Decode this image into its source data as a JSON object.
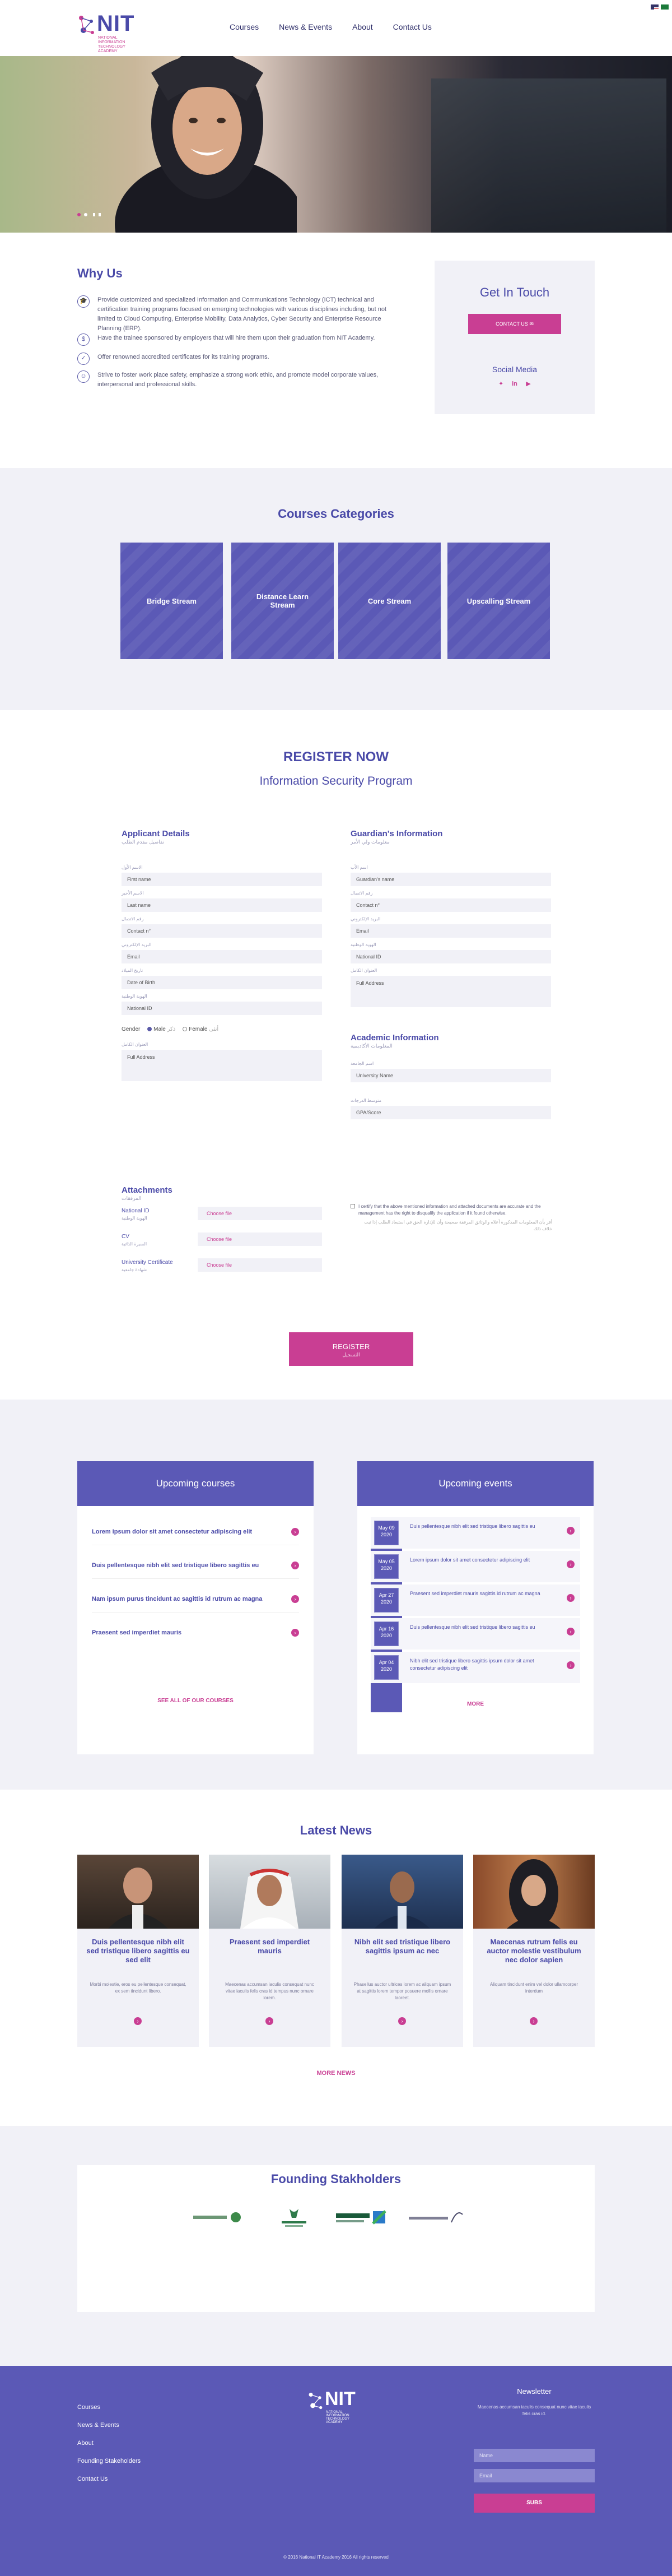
{
  "header": {
    "logo_text": "NIT",
    "logo_subtitle": "NATIONAL INFORMATION TECHNOLOGY ACADEMY",
    "nav": [
      "Courses",
      "News & Events",
      "About",
      "Contact Us"
    ]
  },
  "why": {
    "title": "Why Us",
    "items": [
      "Provide customized and specialized Information and Communications Technology (ICT) technical and certification training programs focused on emerging technologies with various disciplines including, but not limited to Cloud Computing, Enterprise Mobility, Data Analytics, Cyber Security and Enterprise Resource Planning (ERP).",
      "Have the trainee sponsored by employers that will hire them upon their graduation from NIT Academy.",
      "Offer renowned accredited certificates for its training programs.",
      "Strive to foster work place safety, emphasize a strong work ethic, and promote model corporate values, interpersonal and professional skills."
    ],
    "icons": [
      "graduation-cap-icon",
      "dollar-icon",
      "certificate-icon",
      "worker-icon"
    ]
  },
  "touch": {
    "title": "Get In Touch",
    "button": "CONTACT US",
    "social_title": "Social Media",
    "social": [
      "twitter-icon",
      "linkedin-icon",
      "youtube-icon"
    ]
  },
  "categories": {
    "title": "Courses Categories",
    "items": [
      "Bridge Stream",
      "Distance Learn Stream",
      "Core Stream",
      "Upscalling Stream"
    ]
  },
  "register": {
    "title": "REGISTER NOW",
    "program": "Information Security Program",
    "applicant": {
      "title": "Applicant Details",
      "subtitle": "تفاصيل مقدم الطلب",
      "fields": [
        {
          "label": "الاسم الأول",
          "placeholder": "First name"
        },
        {
          "label": "الاسم الأخير",
          "placeholder": "Last name"
        },
        {
          "label": "رقم الاتصال",
          "placeholder": "Contact n°"
        },
        {
          "label": "البريد الإلكتروني",
          "placeholder": "Email"
        },
        {
          "label": "تاريخ الميلاد",
          "placeholder": "Date of Birth"
        },
        {
          "label": "الهوية الوطنية",
          "placeholder": "National ID"
        }
      ],
      "gender_label": "Gender",
      "gender_male": "Male",
      "gender_male_ar": "ذكر",
      "gender_female": "Female",
      "gender_female_ar": "أنثى",
      "address_label": "العنوان الكامل",
      "address_placeholder": "Full Address"
    },
    "guardian": {
      "title": "Guardian's Information",
      "subtitle": "معلومات ولي الأمر",
      "fields": [
        {
          "label": "اسم الأب",
          "placeholder": "Guardian's name"
        },
        {
          "label": "رقم الاتصال",
          "placeholder": "Contact n°"
        },
        {
          "label": "البريد الإلكتروني",
          "placeholder": "Email"
        },
        {
          "label": "الهوية الوطنية",
          "placeholder": "National ID"
        }
      ],
      "address_label": "العنوان الكامل",
      "address_placeholder": "Full Address"
    },
    "academic": {
      "title": "Academic Information",
      "subtitle": "المعلومات الأكاديمية",
      "fields": [
        {
          "label": "اسم الجامعة",
          "placeholder": "University Name"
        },
        {
          "label": "متوسط الدرجات",
          "placeholder": "GPA/Score"
        }
      ]
    },
    "attachments": {
      "title": "Attachments",
      "subtitle": "المرفقات",
      "items": [
        {
          "label": "National ID",
          "label_ar": "الهوية الوطنية",
          "button": "Choose file"
        },
        {
          "label": "CV",
          "label_ar": "السيرة الذاتية",
          "button": "Choose file"
        },
        {
          "label": "University Certificate",
          "label_ar": "شهادة جامعية",
          "button": "Choose file"
        }
      ]
    },
    "agree_text": "I certify that the above mentioned information and attached documents are accurate and the management has the right to disqualify the application if it found otherwise.",
    "agree_text_ar": "أقر بأن المعلومات المذكورة أعلاه والوثائق المرفقة صحيحة وأن للإدارة الحق في استبعاد الطلب إذا ثبت خلاف ذلك",
    "button": "REGISTER",
    "button_ar": "التسجيل"
  },
  "upcoming_courses": {
    "title": "Upcoming courses",
    "items": [
      "Lorem ipsum dolor sit amet consectetur adipiscing elit",
      "Duis pellentesque nibh elit sed tristique libero sagittis eu",
      "Nam ipsum purus tincidunt ac sagittis id rutrum ac magna",
      "Praesent sed imperdiet mauris"
    ],
    "more": "SEE ALL OF OUR COURSES"
  },
  "upcoming_events": {
    "title": "Upcoming events",
    "items": [
      {
        "day": "May 09",
        "year": "2020",
        "text": "Duis pellentesque nibh elit sed tristique libero sagittis eu"
      },
      {
        "day": "May 05",
        "year": "2020",
        "text": "Lorem ipsum dolor sit amet consectetur adipiscing elit"
      },
      {
        "day": "Apr 27",
        "year": "2020",
        "text": "Praesent sed imperdiet mauris sagittis id rutrum ac magna"
      },
      {
        "day": "Apr 16",
        "year": "2020",
        "text": "Duis pellentesque nibh elit sed tristique libero sagittis eu"
      },
      {
        "day": "Apr 04",
        "year": "2020",
        "text": "Nibh elit sed tristique libero sagittis ipsum dolor sit amet consectetur adipiscing elit"
      }
    ],
    "more": "MORE"
  },
  "news": {
    "title": "Latest News",
    "items": [
      {
        "title": "Duis pellentesque nibh elit sed tristique libero sagittis eu sed elit",
        "text": "Morbi molestie, eros eu pellentesque consequat, ex sem tincidunt libero."
      },
      {
        "title": "Praesent sed imperdiet mauris",
        "text": "Maecenas accumsan iaculis consequat nunc vitae iaculis felis cras id tempus nunc ornare lorem."
      },
      {
        "title": "Nibh elit sed tristique libero sagittis ipsum ac nec",
        "text": "Phasellus auctor ultrices lorem ac aliquam ipsum at sagittis lorem tempor posuere mollis ornare laoreet."
      },
      {
        "title": "Maecenas rutrum felis eu auctor molestie vestibulum nec dolor sapien",
        "text": "Aliquam tincidunt enim vel dolor ullamcorper interdum"
      }
    ],
    "more": "MORE NEWS"
  },
  "stakeholders": {
    "title": "Founding Stakholders",
    "logos": [
      "stakeholder-logo-1",
      "stakeholder-logo-2",
      "stakeholder-logo-3",
      "stakeholder-logo-4"
    ]
  },
  "footer": {
    "links": [
      "Courses",
      "News & Events",
      "About",
      "Founding Stakeholders",
      "Contact Us"
    ],
    "newsletter_title": "Newsletter",
    "newsletter_text": "Maecenas accumsan iaculis consequat nunc vitae iaculis felis cras id.",
    "name_placeholder": "Name",
    "email_placeholder": "Email",
    "subscribe": "SUBS",
    "copyright": "© 2016 National IT Academy 2016          All rights reserved"
  },
  "colors": {
    "primary": "#5b59b6",
    "accent": "#c93e93",
    "light": "#f1f1f7"
  }
}
